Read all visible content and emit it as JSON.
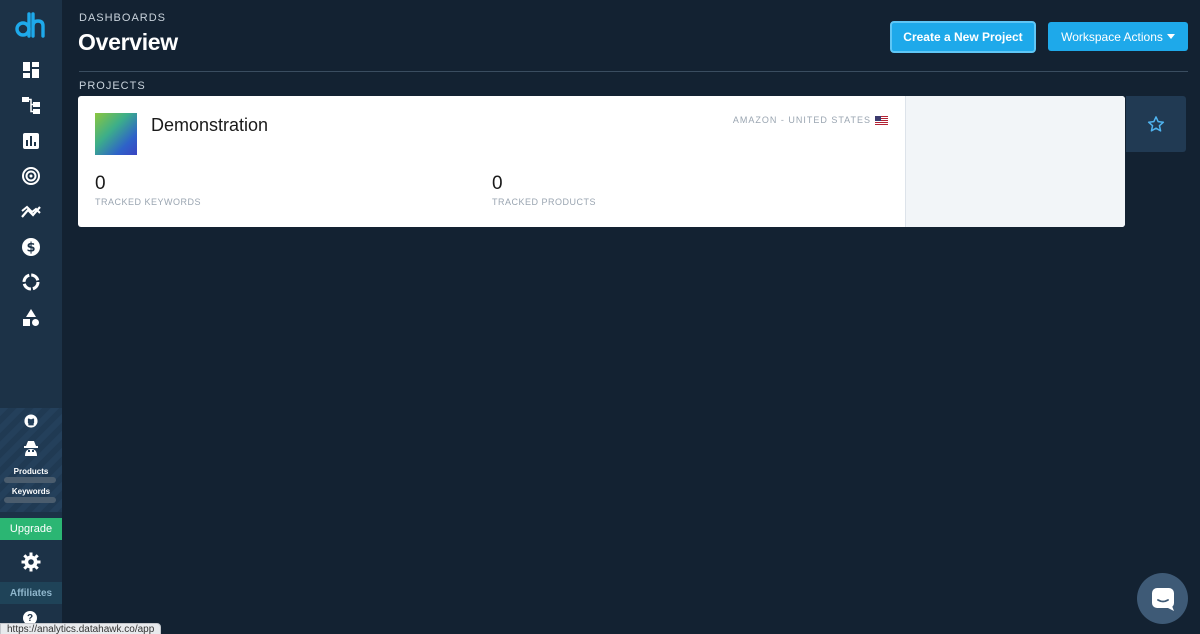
{
  "header": {
    "breadcrumb": "DASHBOARDS",
    "title": "Overview",
    "create_project_label": "Create a New Project",
    "workspace_actions_label": "Workspace Actions"
  },
  "sections": {
    "projects_label": "PROJECTS"
  },
  "project": {
    "name": "Demonstration",
    "marketplace": "AMAZON - UNITED STATES",
    "tracked_keywords_value": "0",
    "tracked_keywords_label": "TRACKED KEYWORDS",
    "tracked_products_value": "0",
    "tracked_products_label": "TRACKED PRODUCTS"
  },
  "sidebar": {
    "logo_text": "dh",
    "nav_icons": [
      "dashboard-icon",
      "hierarchy-icon",
      "bar-chart-icon",
      "target-icon",
      "trend-icon",
      "dollar-icon",
      "ring-icon",
      "shapes-icon"
    ],
    "usage": {
      "products_label": "Products",
      "keywords_label": "Keywords"
    },
    "upgrade_label": "Upgrade",
    "affiliates_label": "Affiliates",
    "help_label": "?"
  },
  "status_bar": {
    "url": "https://analytics.datahawk.co/app"
  },
  "colors": {
    "background": "#132232",
    "sidebar": "#1c3247",
    "accent": "#1ea9ea",
    "upgrade": "#2bb673"
  }
}
